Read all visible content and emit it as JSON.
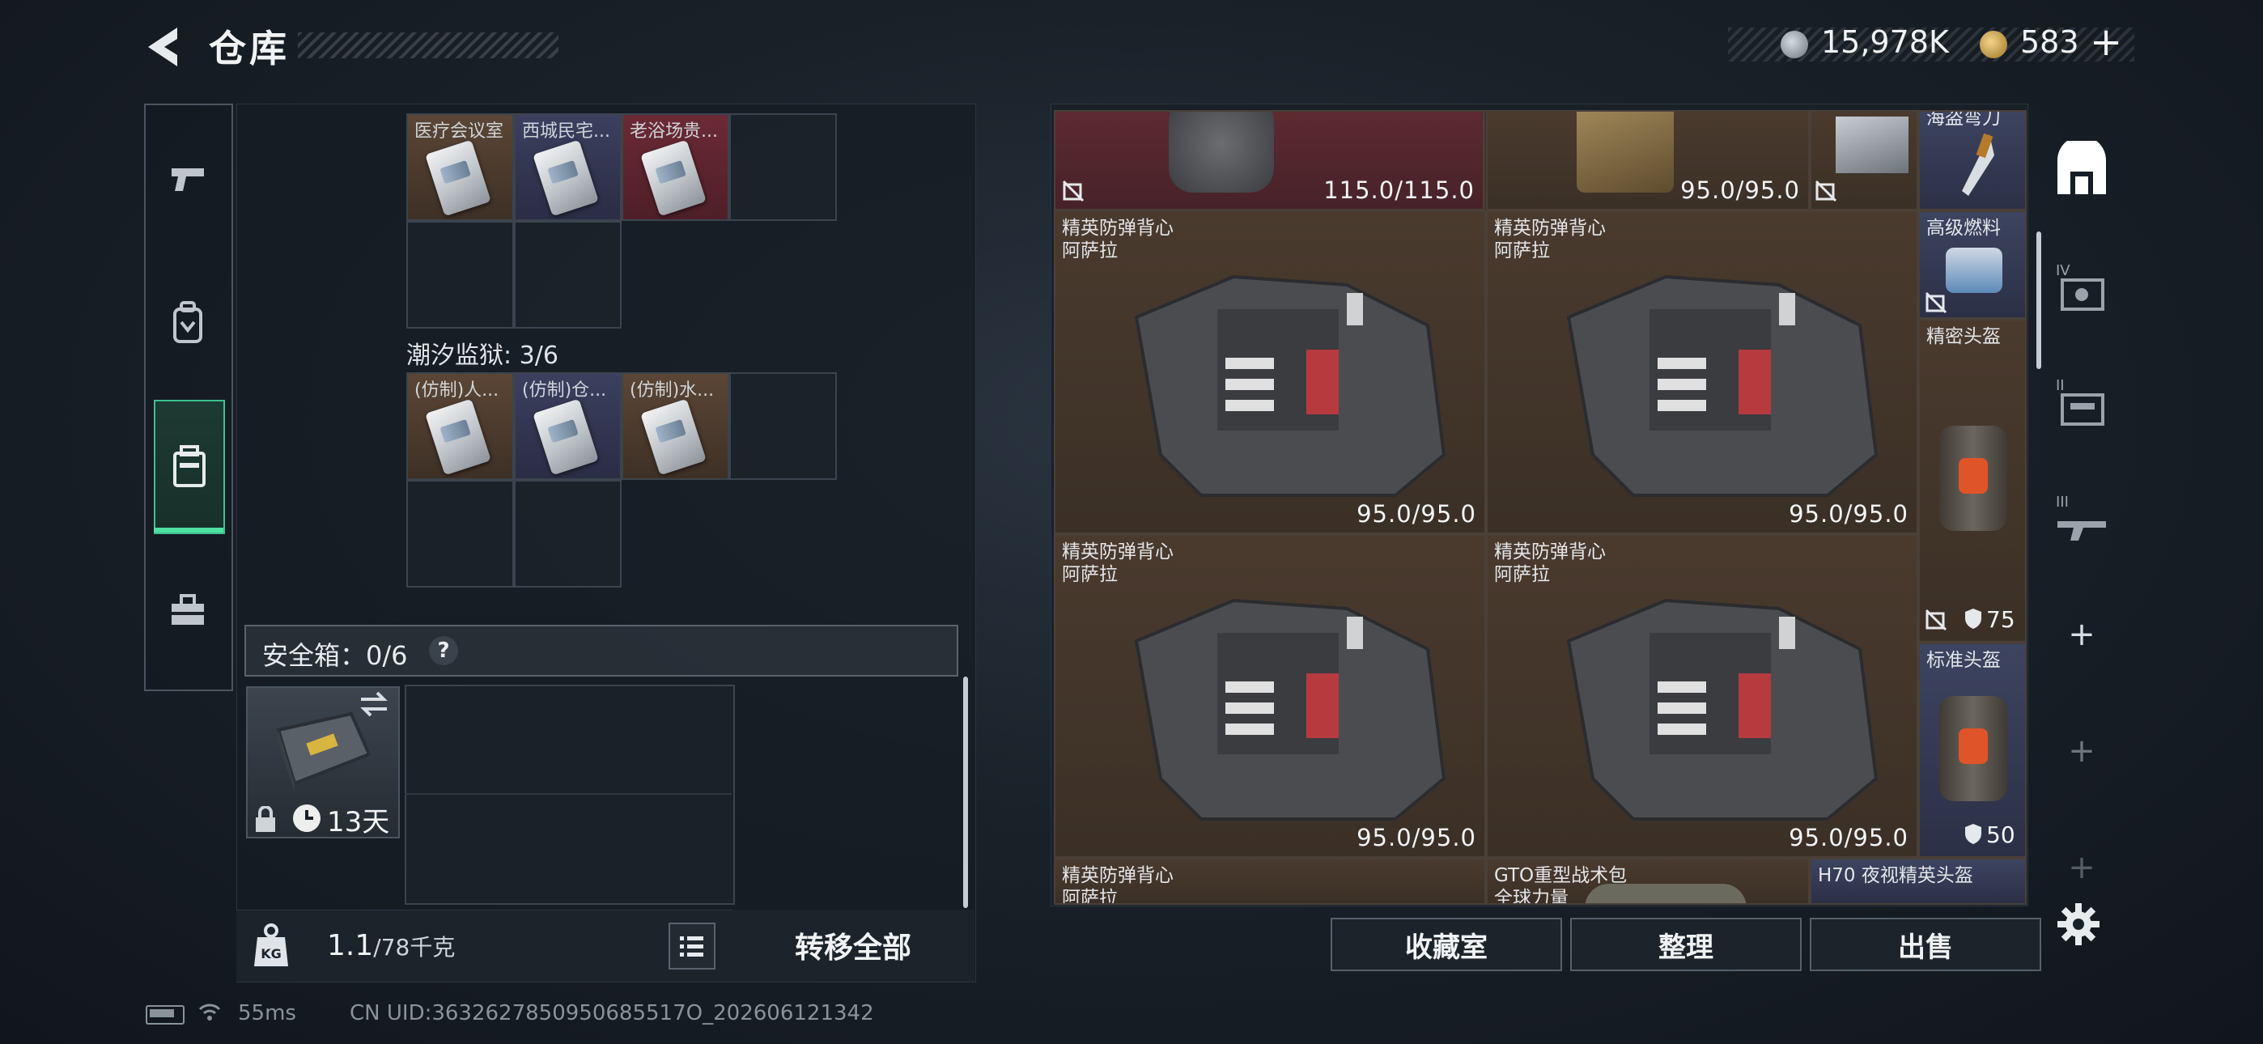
{
  "header": {
    "title": "仓库",
    "currency": [
      {
        "name": "silver",
        "value": "15,978K",
        "color": "#c8cdd2"
      },
      {
        "name": "gold",
        "value": "583",
        "color": "#d9b358"
      }
    ],
    "add_symbol": "+"
  },
  "left_tabs": [
    {
      "id": "weapon",
      "icon": "pistol-icon"
    },
    {
      "id": "backpack",
      "icon": "backpack-icon"
    },
    {
      "id": "case",
      "icon": "case-icon",
      "selected": true
    },
    {
      "id": "kit",
      "icon": "toolbox-icon"
    }
  ],
  "left_panel": {
    "group1": {
      "cards": [
        {
          "label": "医疗会议室",
          "color": "#5b4636"
        },
        {
          "label": "西城民宅...",
          "color": "#3c3f5e"
        },
        {
          "label": "老浴场贵...",
          "color": "#6b2a35"
        }
      ]
    },
    "group2": {
      "label": "潮汐监狱: 3/6",
      "cards": [
        {
          "label": "(仿制)人...",
          "color": "#5b4636"
        },
        {
          "label": "(仿制)仓...",
          "color": "#3c3f5e"
        },
        {
          "label": "(仿制)水...",
          "color": "#5b4636"
        }
      ]
    },
    "safe": {
      "label": "安全箱：0/6",
      "help": "?",
      "days": "13天"
    },
    "weight": {
      "value": "1.1",
      "max": "/78千克"
    },
    "transfer_all": "转移全部"
  },
  "right_panel": {
    "top_row": [
      {
        "durability": "115.0/115.0"
      },
      {
        "durability": "95.0/95.0"
      },
      {
        "name": "海盗弯刀"
      }
    ],
    "vests": [
      {
        "name1": "精英防弹背心",
        "name2": "阿萨拉",
        "durability": "95.0/95.0"
      },
      {
        "name1": "精英防弹背心",
        "name2": "阿萨拉",
        "durability": "95.0/95.0"
      },
      {
        "name1": "精英防弹背心",
        "name2": "阿萨拉",
        "durability": "95.0/95.0"
      },
      {
        "name1": "精英防弹背心",
        "name2": "阿萨拉",
        "durability": "95.0/95.0"
      }
    ],
    "side_items": [
      {
        "name": "高级燃料"
      },
      {
        "name": "精密头盔",
        "stat": "75"
      },
      {
        "name": "标准头盔",
        "stat": "50"
      }
    ],
    "bottom_row": [
      {
        "name1": "精英防弹背心",
        "name2": "阿萨拉"
      },
      {
        "name1": "GTO重型战术包",
        "name2": "全球力量"
      },
      {
        "name1": "H70 夜视精英头盔"
      }
    ]
  },
  "right_tabs": [
    "home-icon",
    "stash-iv-icon",
    "stash-ii-icon",
    "stash-iii-icon"
  ],
  "buttons": {
    "collect": "收藏室",
    "sort": "整理",
    "sell": "出售"
  },
  "status": {
    "ping": "55ms",
    "uid": "CN UID:3632627850950685517O_202606121342"
  }
}
